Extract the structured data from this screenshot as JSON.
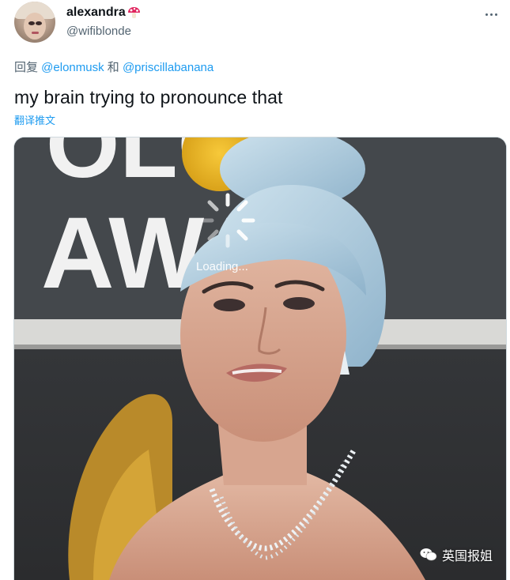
{
  "user": {
    "display_name": "alexandra",
    "name_emoji": "mushroom-emoji",
    "handle": "@wifiblonde"
  },
  "reply_line": {
    "prefix": "回复 ",
    "mention_1": "@elonmusk",
    "joiner": " 和 ",
    "mention_2": "@priscillabanana"
  },
  "tweet": {
    "text": "my brain trying to pronounce that",
    "translate_label": "翻译推文"
  },
  "media": {
    "sign_letters_top": "OLO",
    "sign_letters_bottom": "AWA",
    "loading_label": "Loading..."
  },
  "watermark": {
    "label": "英国报姐"
  },
  "colors": {
    "link": "#1d9bf0",
    "secondary_text": "#536471",
    "primary_text": "#0f1419"
  }
}
